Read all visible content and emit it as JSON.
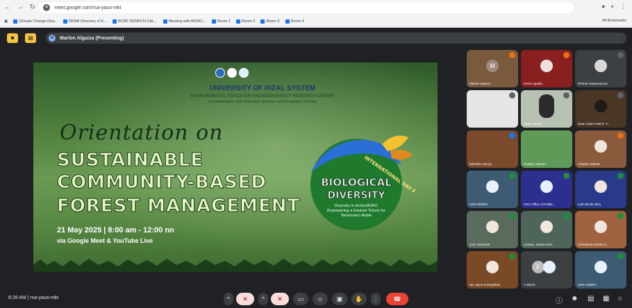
{
  "browser": {
    "url": "meet.google.com/rsa-yauo-mkt",
    "bookmarks": [
      "Climate Change Dea...",
      "DENR Directory of K...",
      "RCBF DENRCN CAL...",
      "Meeting with BIOAC...",
      "Room 1",
      "Room 2",
      "Room 3",
      "Room 4"
    ],
    "all_bookmarks": "All Bookmarks"
  },
  "meet": {
    "presenting_label": "Marlon Alguiza (Presenting)",
    "time": "8:26 AM",
    "meeting_code": "rsa-yauo-mkt"
  },
  "slide": {
    "university": "UNIVERSITY OF RIZAL SYSTEM",
    "center": "ENVIRONMENTAL EDUCATION AND BIODIVERSITY RESEARCH CENTER",
    "collab": "in collaboration with Extension Services and Production Service",
    "orientation": "Orientation on",
    "line1": "SUSTAINABLE",
    "line2": "COMMUNITY-BASED",
    "line3": "FOREST MANAGEMENT",
    "date": "21 May 2025 | 8:00 am - 12:00 nn",
    "via": "via Google Meet & YouTube Live",
    "badge_top": "INTERNATIONAL DAY FOR",
    "badge_l1": "BIOLOGICAL",
    "badge_l2": "DIVERSITY",
    "badge_sub1": "Diversity in Action/BUR3:",
    "badge_sub2": "Empowering a Greener Future for",
    "badge_sub3": "Tomorrow's Noble"
  },
  "participants": [
    {
      "name": "Marlon Alguiza",
      "initial": "M"
    },
    {
      "name": "Kevin Aguiba"
    },
    {
      "name": "Rhimar Nasamuscan"
    },
    {
      "name": ""
    },
    {
      "name": "April Colloso"
    },
    {
      "name": "Sean Owen Neil E. T..."
    },
    {
      "name": "Michelle Garcia"
    },
    {
      "name": "Charlyn Galvan"
    },
    {
      "name": "Charlyn Delmar"
    },
    {
      "name": "URS EEBRC"
    },
    {
      "name": "URS Office of Public..."
    },
    {
      "name": "Carl Nicole Nery"
    },
    {
      "name": "Jeric Samonte"
    },
    {
      "name": "Lozano, Harvie Earl..."
    },
    {
      "name": "Christynne Nicole G..."
    },
    {
      "name": "SE Joyce Evangelista"
    },
    {
      "name": "7 others",
      "initial": "F"
    },
    {
      "name": "URS CEBRC"
    }
  ],
  "colors": {
    "meet_bg": "#202124",
    "leave_red": "#ea4335",
    "accent_yellow": "#f6c343"
  }
}
